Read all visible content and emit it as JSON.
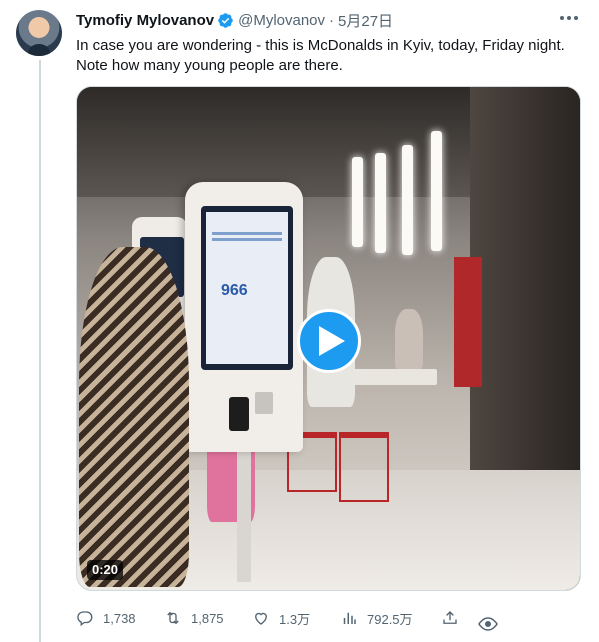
{
  "tweet": {
    "author_name": "Tymofiy Mylovanov",
    "handle": "@Mylovanov",
    "separator": "·",
    "date": "5月27日",
    "text": "In case you are wondering - this is McDonalds in Kyiv, today, Friday night. Note how many young people are there.",
    "verified_color": "#1d9bf0"
  },
  "media": {
    "duration": "0:20",
    "kiosk_number": "966",
    "play_button_color": "#1d9bf0"
  },
  "actions": {
    "replies": "1,738",
    "retweets": "1,875",
    "likes": "1.3万",
    "views": "792.5万"
  },
  "icons": {
    "verified": "verified-badge-icon",
    "more": "more-dots-icon",
    "reply": "reply-icon",
    "retweet": "retweet-icon",
    "like": "heart-icon",
    "views": "analytics-icon",
    "share": "share-icon",
    "eye": "eye-icon"
  }
}
